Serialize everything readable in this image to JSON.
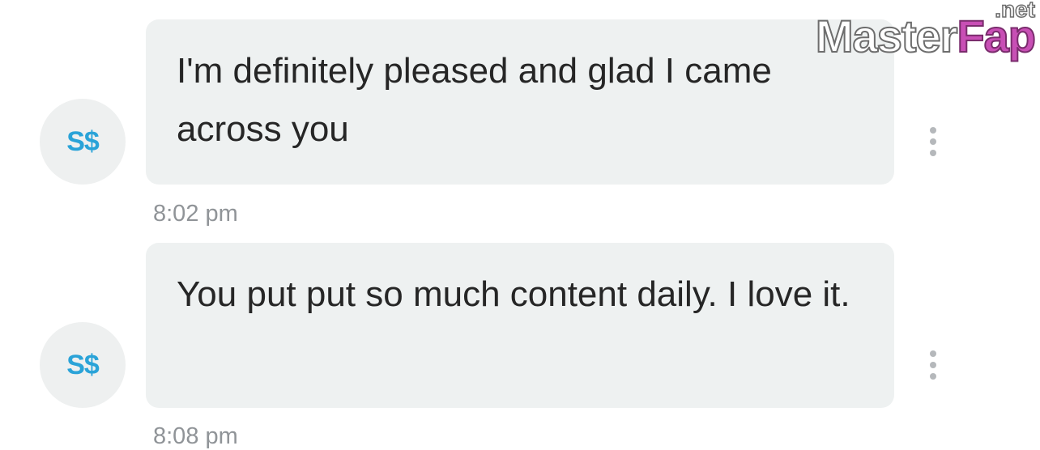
{
  "messages": [
    {
      "avatar": "S$",
      "text": "I'm definitely pleased and glad I came across you",
      "time": "8:02 pm"
    },
    {
      "avatar": "S$",
      "text": "You put put so much content daily. I love it.",
      "time": "8:08 pm"
    }
  ],
  "icons": {
    "more": "more-vertical-icon"
  },
  "watermark": {
    "main_a": "Master",
    "main_b": "Fap",
    "suffix": ".net"
  },
  "colors": {
    "avatar_text": "#2aa3d8",
    "bubble_bg": "#eef1f1",
    "timestamp": "#909498"
  }
}
